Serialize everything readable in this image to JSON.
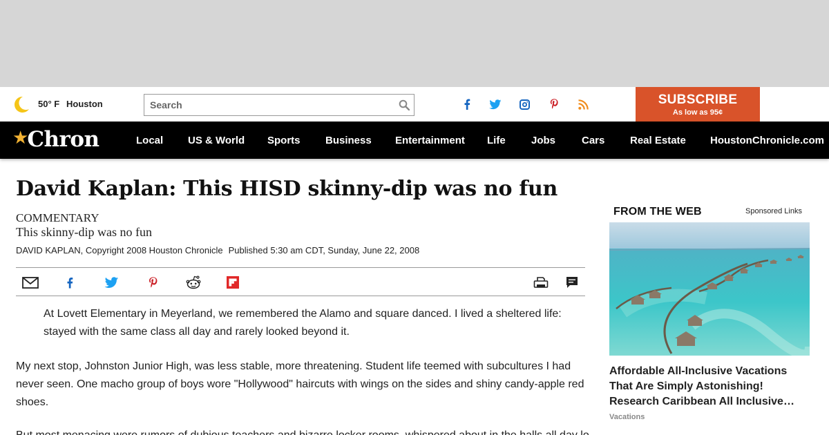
{
  "weather": {
    "temp": "50° F",
    "city": "Houston",
    "icon": "moon-icon"
  },
  "search": {
    "placeholder": "Search"
  },
  "social_top": [
    "facebook-icon",
    "twitter-icon",
    "instagram-icon",
    "pinterest-icon",
    "rss-icon"
  ],
  "subscribe": {
    "label": "SUBSCRIBE",
    "sub": "As low as 95¢",
    "color": "#d9532a"
  },
  "logo": {
    "text": "Chron",
    "star_color": "#f2b233"
  },
  "nav": [
    "Local",
    "US & World",
    "Sports",
    "Business",
    "Entertainment",
    "Life",
    "Jobs",
    "Cars",
    "Real Estate",
    "HoustonChronicle.com"
  ],
  "article": {
    "headline": "David Kaplan: This HISD skinny-dip was no fun",
    "kicker": "COMMENTARY",
    "subhead": "This skinny-dip was no fun",
    "byline": "DAVID KAPLAN, Copyright 2008 Houston Chronicle",
    "published": "Published 5:30 am CDT, Sunday, June 22, 2008",
    "paragraphs": [
      "At Lovett Elementary in Meyerland, we remembered the Alamo and square danced. I lived a sheltered life: stayed with the same class all day and rarely looked beyond it.",
      "My next stop, Johnston Junior High, was less stable, more threatening. Student life teemed with subcultures I had never seen. One macho group of boys wore \"Hollywood\" haircuts with wings on the sides and shiny candy-apple red shoes.",
      "But most menacing were rumors of dubious teachers and bizarre locker rooms, whispered about in the halls all day long by those who had gone before."
    ]
  },
  "share_icons": [
    "email-icon",
    "facebook-icon",
    "twitter-icon",
    "pinterest-icon",
    "reddit-icon",
    "flipboard-icon",
    "print-icon",
    "comments-icon"
  ],
  "sidebar": {
    "heading": "FROM THE WEB",
    "sponsored": "Sponsored Links",
    "promo": {
      "title_lines": [
        "Affordable All-Inclusive Vacations",
        "That Are Simply Astonishing!",
        "Research Caribbean All Inclusive…"
      ],
      "source": "Vacations"
    }
  },
  "colors": {
    "nav_bg": "#000000",
    "ad_bg": "#d6d6d6",
    "accent": "#d9532a"
  }
}
